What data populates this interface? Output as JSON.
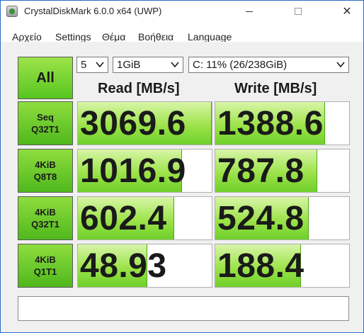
{
  "window": {
    "title": "CrystalDiskMark 6.0.0 x64 (UWP)"
  },
  "menu": {
    "items": [
      "Αρχείο",
      "Settings",
      "Θέμα",
      "Βοήθεια",
      "Language"
    ]
  },
  "controls": {
    "all_label": "All",
    "count": "5",
    "size": "1GiB",
    "drive": "C: 11% (26/238GiB)"
  },
  "headers": {
    "read": "Read [MB/s]",
    "write": "Write [MB/s]"
  },
  "tests": [
    {
      "label_line1": "Seq",
      "label_line2": "Q32T1",
      "read": "3069.6",
      "write": "1388.6",
      "read_fill": 1.0,
      "write_fill": 0.82
    },
    {
      "label_line1": "4KiB",
      "label_line2": "Q8T8",
      "read": "1016.9",
      "write": "787.8",
      "read_fill": 0.78,
      "write_fill": 0.76
    },
    {
      "label_line1": "4KiB",
      "label_line2": "Q32T1",
      "read": "602.4",
      "write": "524.8",
      "read_fill": 0.72,
      "write_fill": 0.7
    },
    {
      "label_line1": "4KiB",
      "label_line2": "Q1T1",
      "read": "48.93",
      "write": "188.4",
      "read_fill": 0.52,
      "write_fill": 0.64
    }
  ],
  "comment": {
    "value": ""
  }
}
